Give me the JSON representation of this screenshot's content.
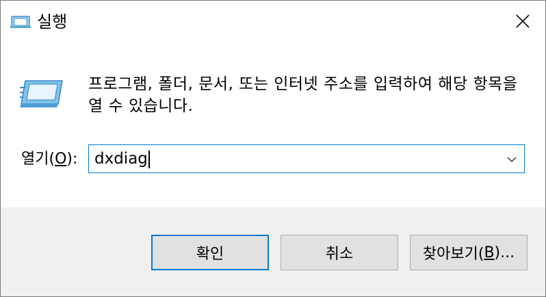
{
  "window": {
    "title": "실행",
    "title_icon": "run-icon",
    "close_icon": "close-icon"
  },
  "main": {
    "icon": "run-icon",
    "description": "프로그램, 폴더, 문서, 또는 인터넷 주소를 입력하여 해당 항목을 열 수 있습니다.",
    "open_label_prefix": "열기(",
    "open_label_accel": "O",
    "open_label_suffix": "):",
    "input_value": "dxdiag",
    "dropdown_icon": "chevron-down-icon"
  },
  "buttons": {
    "ok": "확인",
    "cancel": "취소",
    "browse_prefix": "찾아보기(",
    "browse_accel": "B",
    "browse_suffix": ")..."
  },
  "colors": {
    "accent": "#0078d7",
    "footer_bg": "#f0f0f0",
    "button_bg": "#e1e1e1"
  }
}
